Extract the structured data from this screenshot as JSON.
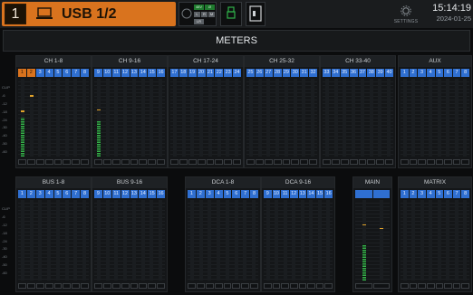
{
  "topbar": {
    "channel_number": "1",
    "channel_name": "USB 1/2",
    "source_icon": "laptop-icon",
    "status_tags": [
      "48V",
      "Ø",
      "L",
      "R",
      "M",
      "LR"
    ],
    "settings_label": "SETTINGS",
    "time": "15:14:19",
    "date": "2024-01-25"
  },
  "page": {
    "title": "METERS"
  },
  "scale_labels": [
    "CLIP",
    "-6",
    "-12",
    "-18",
    "-24",
    "-30",
    "-40",
    "-50",
    "-60"
  ],
  "meters_top": [
    {
      "title": "CH 1-8",
      "chips": [
        "1",
        "2",
        "3",
        "4",
        "5",
        "6",
        "7",
        "8"
      ],
      "active": [
        0,
        1
      ],
      "levels": [
        0.5,
        0,
        0,
        0,
        0,
        0,
        0,
        0
      ],
      "peaks": [
        0.57,
        0.77,
        0,
        0,
        0,
        0,
        0,
        0
      ]
    },
    {
      "title": "CH 9-16",
      "chips": [
        "9",
        "10",
        "11",
        "12",
        "13",
        "14",
        "15",
        "16"
      ],
      "active": [],
      "levels": [
        0.45,
        0,
        0,
        0,
        0,
        0,
        0,
        0
      ],
      "peaks": [
        0.59,
        0,
        0,
        0,
        0,
        0,
        0,
        0
      ]
    },
    {
      "title": "CH 17-24",
      "chips": [
        "17",
        "18",
        "19",
        "20",
        "21",
        "22",
        "23",
        "24"
      ],
      "active": [],
      "levels": [
        0,
        0,
        0,
        0,
        0,
        0,
        0,
        0
      ],
      "peaks": [
        0,
        0,
        0,
        0,
        0,
        0,
        0,
        0
      ]
    },
    {
      "title": "CH 25-32",
      "chips": [
        "25",
        "26",
        "27",
        "28",
        "29",
        "30",
        "31",
        "32"
      ],
      "active": [],
      "levels": [
        0,
        0,
        0,
        0,
        0,
        0,
        0,
        0
      ],
      "peaks": [
        0,
        0,
        0,
        0,
        0,
        0,
        0,
        0
      ]
    },
    {
      "title": "CH 33-40",
      "chips": [
        "33",
        "34",
        "35",
        "36",
        "37",
        "38",
        "39",
        "40"
      ],
      "active": [],
      "levels": [
        0,
        0,
        0,
        0,
        0,
        0,
        0,
        0
      ],
      "peaks": [
        0,
        0,
        0,
        0,
        0,
        0,
        0,
        0
      ]
    },
    {
      "title": "AUX",
      "chips": [
        "1",
        "2",
        "3",
        "4",
        "5",
        "6",
        "7",
        "8"
      ],
      "active": [],
      "levels": [
        0,
        0,
        0,
        0,
        0,
        0,
        0,
        0
      ],
      "peaks": [
        0,
        0,
        0,
        0,
        0,
        0,
        0,
        0
      ]
    }
  ],
  "meters_bottom": [
    {
      "title": "BUS 1-8",
      "chips": [
        "1",
        "2",
        "3",
        "4",
        "5",
        "6",
        "7",
        "8"
      ],
      "active": [],
      "levels": [
        0,
        0,
        0,
        0,
        0,
        0,
        0,
        0
      ],
      "peaks": [
        0,
        0,
        0,
        0,
        0,
        0,
        0,
        0
      ]
    },
    {
      "title": "BUS 9-16",
      "chips": [
        "9",
        "10",
        "11",
        "12",
        "13",
        "14",
        "15",
        "16"
      ],
      "active": [],
      "levels": [
        0,
        0,
        0,
        0,
        0,
        0,
        0,
        0
      ],
      "peaks": [
        0,
        0,
        0,
        0,
        0,
        0,
        0,
        0
      ]
    },
    {
      "title": "DCA 1-8",
      "chips": [
        "1",
        "2",
        "3",
        "4",
        "5",
        "6",
        "7",
        "8"
      ],
      "active": [],
      "levels": [
        0,
        0,
        0,
        0,
        0,
        0,
        0,
        0
      ],
      "peaks": [
        0,
        0,
        0,
        0,
        0,
        0,
        0,
        0
      ]
    },
    {
      "title": "DCA 9-16",
      "chips": [
        "9",
        "10",
        "11",
        "12",
        "13",
        "14",
        "15",
        "16"
      ],
      "active": [],
      "levels": [
        0,
        0,
        0,
        0,
        0,
        0,
        0,
        0
      ],
      "peaks": [
        0,
        0,
        0,
        0,
        0,
        0,
        0,
        0
      ]
    },
    {
      "title": "MAIN",
      "chips": [
        "",
        ""
      ],
      "active": [],
      "levels": [
        0.45,
        0
      ],
      "peaks": [
        0.68,
        0.64
      ]
    },
    {
      "title": "MATRIX",
      "chips": [
        "1",
        "2",
        "3",
        "4",
        "5",
        "6",
        "7",
        "8"
      ],
      "active": [],
      "levels": [
        0,
        0,
        0,
        0,
        0,
        0,
        0,
        0
      ],
      "peaks": [
        0,
        0,
        0,
        0,
        0,
        0,
        0,
        0
      ]
    }
  ],
  "colors": {
    "accent": "#d9731e",
    "chip_blue": "#2f6fd1",
    "meter_green": "#35b04a",
    "peak": "#e0a22a"
  }
}
